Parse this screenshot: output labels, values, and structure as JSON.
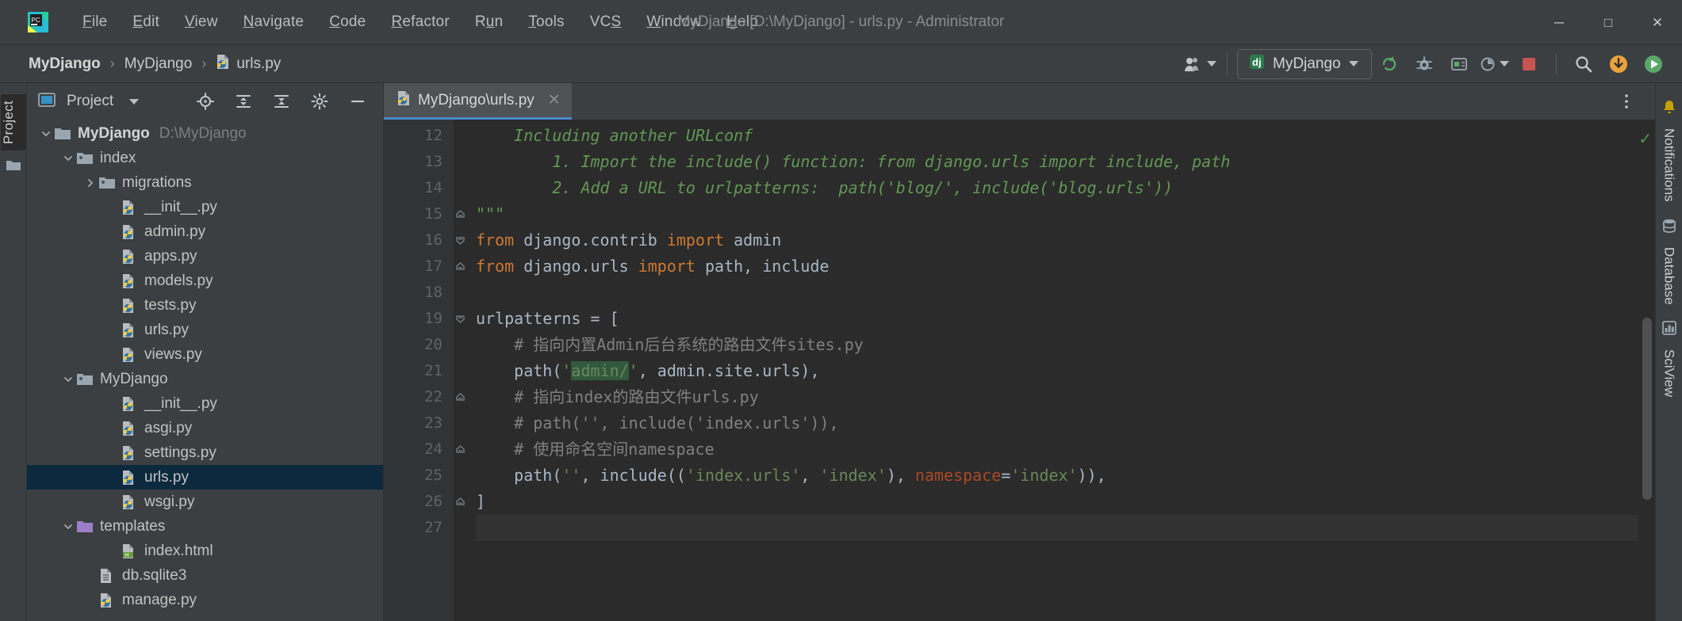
{
  "window": {
    "title": "MyDjango [D:\\MyDjango] - urls.py - Administrator",
    "minimize_icon": "minimize-icon",
    "maximize_icon": "maximize-icon",
    "close_icon": "close-icon",
    "minimize_glyph": "─",
    "maximize_glyph": "□",
    "close_glyph": "✕"
  },
  "menu": {
    "logo_name": "pycharm-logo",
    "items": [
      {
        "label": "File",
        "mnemonic": "F"
      },
      {
        "label": "Edit",
        "mnemonic": "E"
      },
      {
        "label": "View",
        "mnemonic": "V"
      },
      {
        "label": "Navigate",
        "mnemonic": "N"
      },
      {
        "label": "Code",
        "mnemonic": "C"
      },
      {
        "label": "Refactor",
        "mnemonic": "R"
      },
      {
        "label": "Run",
        "mnemonic": "u"
      },
      {
        "label": "Tools",
        "mnemonic": "T"
      },
      {
        "label": "VCS",
        "mnemonic": "S"
      },
      {
        "label": "Window",
        "mnemonic": "W"
      },
      {
        "label": "Help",
        "mnemonic": "H"
      }
    ]
  },
  "navbar": {
    "breadcrumbs": [
      {
        "label": "MyDjango",
        "icon": "",
        "bold": true
      },
      {
        "label": "MyDjango",
        "icon": "",
        "bold": false
      },
      {
        "label": "urls.py",
        "icon": "python-file-icon",
        "bold": false
      }
    ],
    "separator": "›",
    "account_icon": "account-icon",
    "run_config": {
      "label": "MyDjango",
      "icon": "django-run-config-icon"
    },
    "actions": [
      {
        "name": "rerun-icon",
        "glyph": "↻",
        "color": "#59a869"
      },
      {
        "name": "debug-icon",
        "glyph": "🐞",
        "color": "#a9b7c6"
      },
      {
        "name": "coverage-icon",
        "glyph": "▣",
        "color": "#9aa7b0"
      },
      {
        "name": "profile-icon",
        "glyph": "◔",
        "color": "#9aa7b0"
      },
      {
        "name": "stop-icon",
        "glyph": "■",
        "color": "#c75450"
      },
      {
        "name": "search-everywhere-icon",
        "glyph": "🔍",
        "color": "#b9c2cb"
      },
      {
        "name": "update-project-icon",
        "glyph": "⬇",
        "color": "#e8a33d"
      },
      {
        "name": "run-icon",
        "glyph": "▶",
        "color": "#59a869"
      }
    ]
  },
  "left_rail": {
    "label": "Project",
    "structure_icon": "folder-icon"
  },
  "project_panel": {
    "title": "Project",
    "panel_icon": "project-view-icon",
    "dropdown_icon": "chevron-down-icon",
    "tools": [
      {
        "name": "locate-icon",
        "glyph": "⊕"
      },
      {
        "name": "expand-all-icon",
        "glyph": "⬍"
      },
      {
        "name": "collapse-all-icon",
        "glyph": "⬌"
      },
      {
        "name": "settings-gear-icon",
        "glyph": "⚙"
      },
      {
        "name": "hide-panel-icon",
        "glyph": "─"
      }
    ],
    "tree": [
      {
        "indent": 0,
        "arrow": "down",
        "icon": "folder-icon",
        "label": "MyDjango",
        "sub": "D:\\MyDjango",
        "bold": true,
        "selected": false
      },
      {
        "indent": 1,
        "arrow": "down",
        "icon": "module-folder-icon",
        "label": "index",
        "sub": "",
        "bold": false,
        "selected": false
      },
      {
        "indent": 2,
        "arrow": "right",
        "icon": "module-folder-icon",
        "label": "migrations",
        "sub": "",
        "bold": false,
        "selected": false
      },
      {
        "indent": 3,
        "arrow": "none",
        "icon": "python-file-icon",
        "label": "__init__.py",
        "sub": "",
        "bold": false,
        "selected": false
      },
      {
        "indent": 3,
        "arrow": "none",
        "icon": "python-file-icon",
        "label": "admin.py",
        "sub": "",
        "bold": false,
        "selected": false
      },
      {
        "indent": 3,
        "arrow": "none",
        "icon": "python-file-icon",
        "label": "apps.py",
        "sub": "",
        "bold": false,
        "selected": false
      },
      {
        "indent": 3,
        "arrow": "none",
        "icon": "python-file-icon",
        "label": "models.py",
        "sub": "",
        "bold": false,
        "selected": false
      },
      {
        "indent": 3,
        "arrow": "none",
        "icon": "python-file-icon",
        "label": "tests.py",
        "sub": "",
        "bold": false,
        "selected": false
      },
      {
        "indent": 3,
        "arrow": "none",
        "icon": "python-file-icon",
        "label": "urls.py",
        "sub": "",
        "bold": false,
        "selected": false
      },
      {
        "indent": 3,
        "arrow": "none",
        "icon": "python-file-icon",
        "label": "views.py",
        "sub": "",
        "bold": false,
        "selected": false
      },
      {
        "indent": 1,
        "arrow": "down",
        "icon": "module-folder-icon",
        "label": "MyDjango",
        "sub": "",
        "bold": false,
        "selected": false
      },
      {
        "indent": 3,
        "arrow": "none",
        "icon": "python-file-icon",
        "label": "__init__.py",
        "sub": "",
        "bold": false,
        "selected": false
      },
      {
        "indent": 3,
        "arrow": "none",
        "icon": "python-file-icon",
        "label": "asgi.py",
        "sub": "",
        "bold": false,
        "selected": false
      },
      {
        "indent": 3,
        "arrow": "none",
        "icon": "python-file-icon",
        "label": "settings.py",
        "sub": "",
        "bold": false,
        "selected": false
      },
      {
        "indent": 3,
        "arrow": "none",
        "icon": "python-file-icon",
        "label": "urls.py",
        "sub": "",
        "bold": false,
        "selected": true
      },
      {
        "indent": 3,
        "arrow": "none",
        "icon": "python-file-icon",
        "label": "wsgi.py",
        "sub": "",
        "bold": false,
        "selected": false
      },
      {
        "indent": 1,
        "arrow": "down",
        "icon": "templates-folder-icon",
        "label": "templates",
        "sub": "",
        "bold": false,
        "selected": false
      },
      {
        "indent": 3,
        "arrow": "none",
        "icon": "html-file-icon",
        "label": "index.html",
        "sub": "",
        "bold": false,
        "selected": false
      },
      {
        "indent": 2,
        "arrow": "none",
        "icon": "database-file-icon",
        "label": "db.sqlite3",
        "sub": "",
        "bold": false,
        "selected": false
      },
      {
        "indent": 2,
        "arrow": "none",
        "icon": "python-file-icon",
        "label": "manage.py",
        "sub": "",
        "bold": false,
        "selected": false
      }
    ]
  },
  "editor": {
    "tab": {
      "label": "MyDjango\\urls.py",
      "icon": "python-file-icon",
      "close_glyph": "✕"
    },
    "more_icon": "more-options-icon",
    "inspection_ok_glyph": "✓",
    "first_visible_line": 12,
    "lines": [
      {
        "num": 12,
        "fold": "",
        "tokens": [
          {
            "t": "    Including another URLconf",
            "c": "doc"
          }
        ]
      },
      {
        "num": 13,
        "fold": "",
        "tokens": [
          {
            "t": "        1. Import the include() function: from django.urls import include, path",
            "c": "doc"
          }
        ]
      },
      {
        "num": 14,
        "fold": "",
        "tokens": [
          {
            "t": "        2. Add a URL to urlpatterns:  path('blog/', include('blog.urls'))",
            "c": "doc"
          }
        ]
      },
      {
        "num": 15,
        "fold": "end",
        "tokens": [
          {
            "t": "\"\"\"",
            "c": "doc"
          }
        ]
      },
      {
        "num": 16,
        "fold": "start",
        "tokens": [
          {
            "t": "from",
            "c": "k"
          },
          {
            "t": " django.contrib ",
            "c": "nm"
          },
          {
            "t": "import",
            "c": "k"
          },
          {
            "t": " admin",
            "c": "nm"
          }
        ]
      },
      {
        "num": 17,
        "fold": "end",
        "tokens": [
          {
            "t": "from",
            "c": "k"
          },
          {
            "t": " django.urls ",
            "c": "nm"
          },
          {
            "t": "import",
            "c": "k"
          },
          {
            "t": " path, include",
            "c": "nm"
          }
        ]
      },
      {
        "num": 18,
        "fold": "",
        "tokens": [
          {
            "t": "",
            "c": "nm"
          }
        ]
      },
      {
        "num": 19,
        "fold": "start",
        "tokens": [
          {
            "t": "urlpatterns = [",
            "c": "nm"
          }
        ]
      },
      {
        "num": 20,
        "fold": "",
        "tokens": [
          {
            "t": "    # 指向内置Admin后台系统的路由文件sites.py",
            "c": "cm"
          }
        ]
      },
      {
        "num": 21,
        "fold": "",
        "tokens": [
          {
            "t": "    path(",
            "c": "nm"
          },
          {
            "t": "'",
            "c": "s"
          },
          {
            "t": "admin/",
            "c": "s hl"
          },
          {
            "t": "'",
            "c": "s"
          },
          {
            "t": ", admin.site.urls),",
            "c": "nm"
          }
        ]
      },
      {
        "num": 22,
        "fold": "end",
        "tokens": [
          {
            "t": "    # 指向index的路由文件urls.py",
            "c": "cm"
          }
        ]
      },
      {
        "num": 23,
        "fold": "",
        "tokens": [
          {
            "t": "    # path('', include('index.urls')),",
            "c": "cm"
          }
        ]
      },
      {
        "num": 24,
        "fold": "end",
        "tokens": [
          {
            "t": "    # 使用命名空间namespace",
            "c": "cm"
          }
        ]
      },
      {
        "num": 25,
        "fold": "",
        "tokens": [
          {
            "t": "    path(",
            "c": "nm"
          },
          {
            "t": "''",
            "c": "s"
          },
          {
            "t": ", include((",
            "c": "nm"
          },
          {
            "t": "'index.urls'",
            "c": "s"
          },
          {
            "t": ", ",
            "c": "nm"
          },
          {
            "t": "'index'",
            "c": "s"
          },
          {
            "t": "), ",
            "c": "nm"
          },
          {
            "t": "namespace",
            "c": "param"
          },
          {
            "t": "=",
            "c": "nm"
          },
          {
            "t": "'index'",
            "c": "s"
          },
          {
            "t": ")),",
            "c": "nm"
          }
        ]
      },
      {
        "num": 26,
        "fold": "end",
        "tokens": [
          {
            "t": "]",
            "c": "nm"
          }
        ]
      },
      {
        "num": 27,
        "fold": "",
        "tokens": [
          {
            "t": "",
            "c": "nm"
          }
        ],
        "current": true
      }
    ]
  },
  "right_rail": {
    "items": [
      {
        "name": "notifications-icon",
        "label": "Notifications",
        "glyph": "🔔"
      },
      {
        "name": "database-icon",
        "label": "Database",
        "glyph": "▤"
      },
      {
        "name": "sciview-icon",
        "label": "SciView",
        "glyph": "▦"
      }
    ]
  },
  "colors": {
    "bg_chrome": "#3c3f41",
    "bg_editor": "#2b2b2b",
    "accent_tab": "#4a88c7",
    "selection": "#0d293e",
    "keyword": "#cc7832",
    "string": "#6a8759",
    "comment": "#808080",
    "docstring": "#629755",
    "text": "#a9b7c6"
  }
}
